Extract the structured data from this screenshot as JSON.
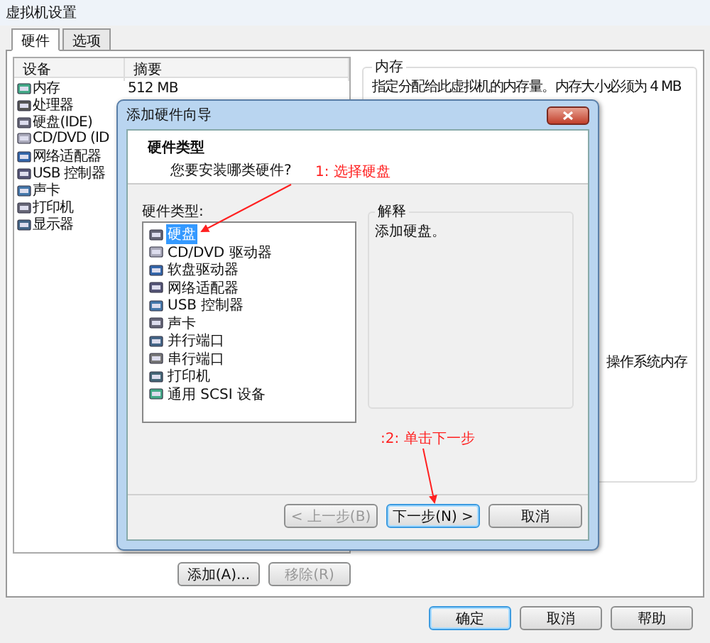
{
  "window": {
    "title": "虚拟机设置"
  },
  "tabs": [
    {
      "label": "硬件",
      "selected": true
    },
    {
      "label": "选项",
      "selected": false
    }
  ],
  "device_table": {
    "columns": [
      "设备",
      "摘要"
    ],
    "rows": [
      {
        "device": "内存",
        "summary": "512 MB"
      },
      {
        "device": "处理器"
      },
      {
        "device": "硬盘(IDE)"
      },
      {
        "device": "CD/DVD (ID"
      },
      {
        "device": "网络适配器"
      },
      {
        "device": "USB 控制器"
      },
      {
        "device": "声卡"
      },
      {
        "device": "打印机"
      },
      {
        "device": "显示器"
      }
    ]
  },
  "device_buttons": [
    {
      "label": "添加(A)...",
      "disabled": false
    },
    {
      "label": "移除(R)",
      "disabled": true
    }
  ],
  "memory_group": {
    "title": "内存",
    "description": "指定分配给此虚拟机的内存量。内存大小必须为 4 MB",
    "note": "操作系统内存"
  },
  "footer_buttons": [
    {
      "label": "确定",
      "default": true
    },
    {
      "label": "取消",
      "default": false
    },
    {
      "label": "帮助",
      "default": false
    }
  ],
  "wizard": {
    "title": "添加硬件向导",
    "heading": "硬件类型",
    "subheading": "您要安装哪类硬件?",
    "list_label": "硬件类型:",
    "hardware_types": [
      {
        "label": "硬盘",
        "selected": true
      },
      {
        "label": "CD/DVD 驱动器",
        "selected": false
      },
      {
        "label": "软盘驱动器",
        "selected": false
      },
      {
        "label": "网络适配器",
        "selected": false
      },
      {
        "label": "USB 控制器",
        "selected": false
      },
      {
        "label": "声卡",
        "selected": false
      },
      {
        "label": "并行端口",
        "selected": false
      },
      {
        "label": "串行端口",
        "selected": false
      },
      {
        "label": "打印机",
        "selected": false
      },
      {
        "label": "通用 SCSI 设备",
        "selected": false
      }
    ],
    "explanation": {
      "title": "解释",
      "text": "添加硬盘。"
    },
    "buttons": [
      {
        "label": "< 上一步(B)",
        "disabled": true,
        "default": false
      },
      {
        "label": "下一步(N) >",
        "disabled": false,
        "default": true
      },
      {
        "label": "取消",
        "disabled": false,
        "default": false
      }
    ]
  },
  "annotations": [
    {
      "text": "1: 选择硬盘"
    },
    {
      "text": ":2: 单击下一步"
    }
  ]
}
